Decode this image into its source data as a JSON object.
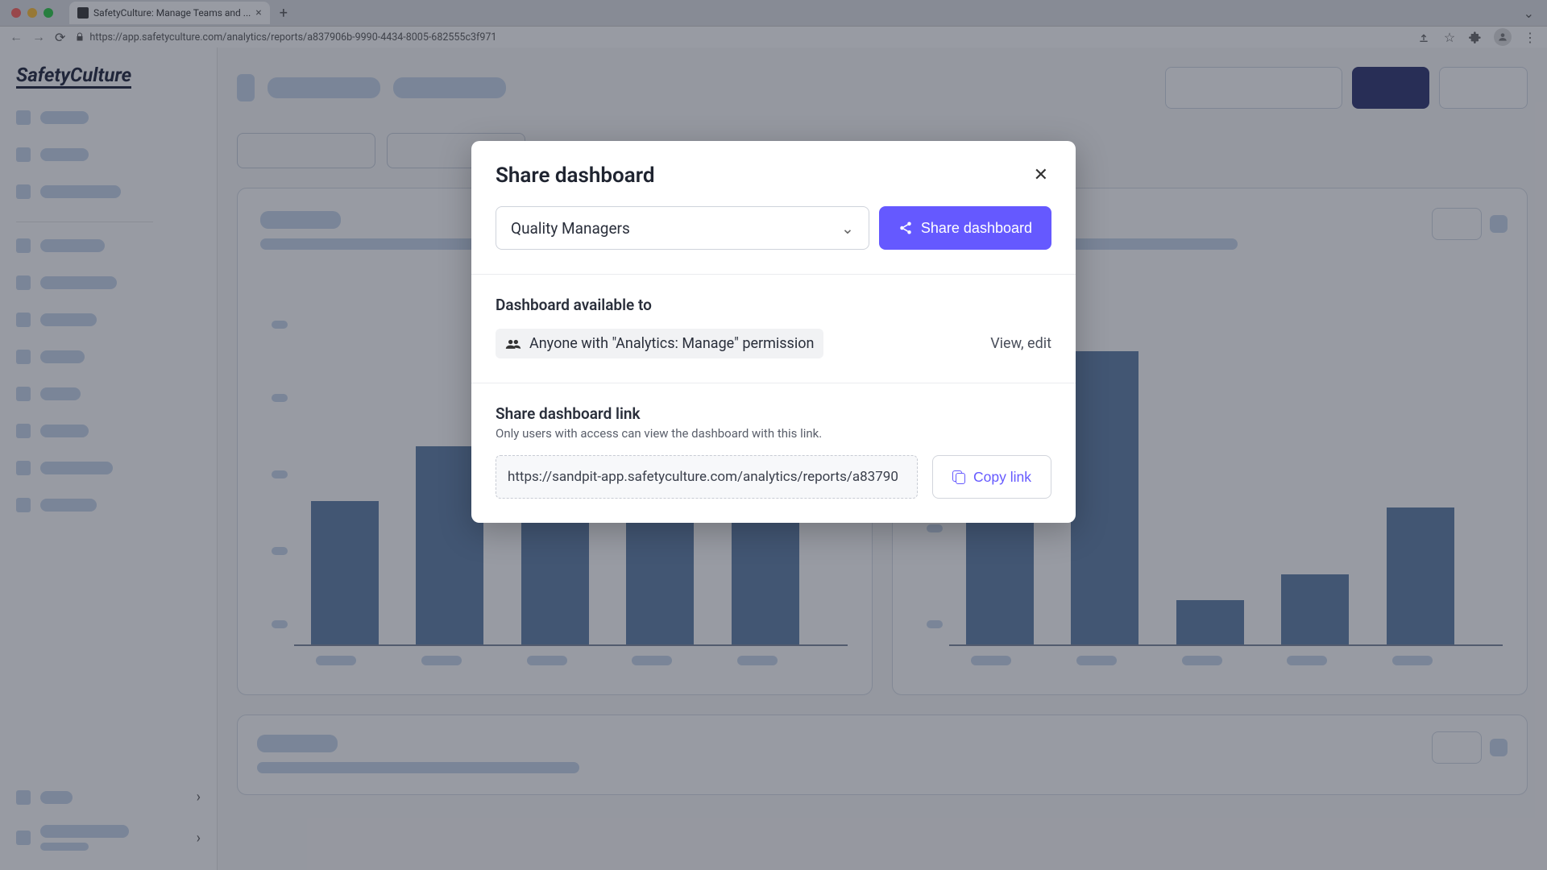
{
  "browser": {
    "tab_title": "SafetyCulture: Manage Teams and ...",
    "url": "https://app.safetyculture.com/analytics/reports/a837906b-9990-4434-8005-682555c3f971"
  },
  "app": {
    "logo": "SafetyCulture"
  },
  "modal": {
    "title": "Share dashboard",
    "selected_group": "Quality Managers",
    "share_button": "Share dashboard",
    "available_heading": "Dashboard available to",
    "permission_text": "Anyone with \"Analytics: Manage\" permission",
    "permission_level": "View, edit",
    "link_heading": "Share dashboard link",
    "link_sub": "Only users with access can view the dashboard with this link.",
    "link_url": "https://sandpit-app.safetyculture.com/analytics/reports/a83790",
    "copy_button": "Copy link"
  },
  "chart_data": [
    {
      "type": "bar",
      "title": "",
      "categories": [
        "",
        "",
        "",
        "",
        ""
      ],
      "values": [
        45,
        62,
        50,
        52,
        44
      ],
      "ylim": [
        0,
        100
      ]
    },
    {
      "type": "bar",
      "title": "",
      "categories": [
        "",
        "",
        "",
        "",
        ""
      ],
      "values": [
        39,
        92,
        14,
        22,
        43
      ],
      "ylim": [
        0,
        100
      ]
    }
  ]
}
